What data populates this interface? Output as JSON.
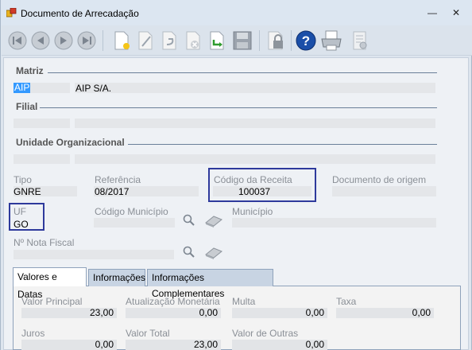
{
  "window": {
    "title": "Documento de Arrecadação",
    "minimize": "—",
    "close": "✕"
  },
  "toolbar": {
    "buttons": [
      {
        "name": "first-icon",
        "glyph": "⏮"
      },
      {
        "name": "previous-icon",
        "glyph": "◀"
      },
      {
        "name": "next-icon",
        "glyph": "▶"
      },
      {
        "name": "last-icon",
        "glyph": "⏭"
      },
      {
        "name": "new-icon",
        "glyph": "✶"
      },
      {
        "name": "edit-icon",
        "glyph": "✎"
      },
      {
        "name": "undo-icon",
        "glyph": "↶"
      },
      {
        "name": "delete-icon",
        "glyph": "✕"
      },
      {
        "name": "export-icon",
        "glyph": "➥"
      },
      {
        "name": "save-icon",
        "glyph": "■"
      },
      {
        "name": "lock-icon",
        "glyph": "🔒"
      },
      {
        "name": "help-icon",
        "glyph": "?"
      },
      {
        "name": "print-icon",
        "glyph": "⎙"
      },
      {
        "name": "report-icon",
        "glyph": "▤"
      }
    ]
  },
  "matriz": {
    "section": "Matriz",
    "code": "AIP",
    "name": "AIP S/A."
  },
  "filial": {
    "section": "Filial"
  },
  "unidade": {
    "section": "Unidade Organizacional"
  },
  "fields": {
    "tipo": {
      "label": "Tipo",
      "value": "GNRE"
    },
    "referencia": {
      "label": "Referência",
      "value": "08/2017"
    },
    "codigo_receita": {
      "label": "Código da Receita",
      "value": "100037"
    },
    "documento_origem": {
      "label": "Documento de origem",
      "value": ""
    },
    "uf": {
      "label": "UF",
      "value": "GO"
    },
    "codigo_municipio": {
      "label": "Código Município",
      "value": ""
    },
    "municipio": {
      "label": "Município",
      "value": ""
    },
    "nota_fiscal": {
      "label": "Nº Nota Fiscal",
      "value": ""
    }
  },
  "tabs": [
    {
      "label": "Valores e Datas",
      "active": true
    },
    {
      "label": "Informações",
      "active": false
    },
    {
      "label": "Informações Complementares",
      "active": false
    }
  ],
  "valores": {
    "valor_principal": {
      "label": "Valor Principal",
      "value": "23,00"
    },
    "atualizacao": {
      "label": "Atualização Monetária",
      "value": "0,00"
    },
    "multa": {
      "label": "Multa",
      "value": "0,00"
    },
    "taxa": {
      "label": "Taxa",
      "value": "0,00"
    },
    "juros": {
      "label": "Juros",
      "value": "0,00"
    },
    "valor_total": {
      "label": "Valor Total",
      "value": "23,00"
    },
    "valor_outras": {
      "label": "Valor de Outras",
      "value": "0,00"
    }
  },
  "colors": {
    "highlight": "#2e3a9c",
    "selection": "#3399ff",
    "help": "#1b4fa8"
  }
}
